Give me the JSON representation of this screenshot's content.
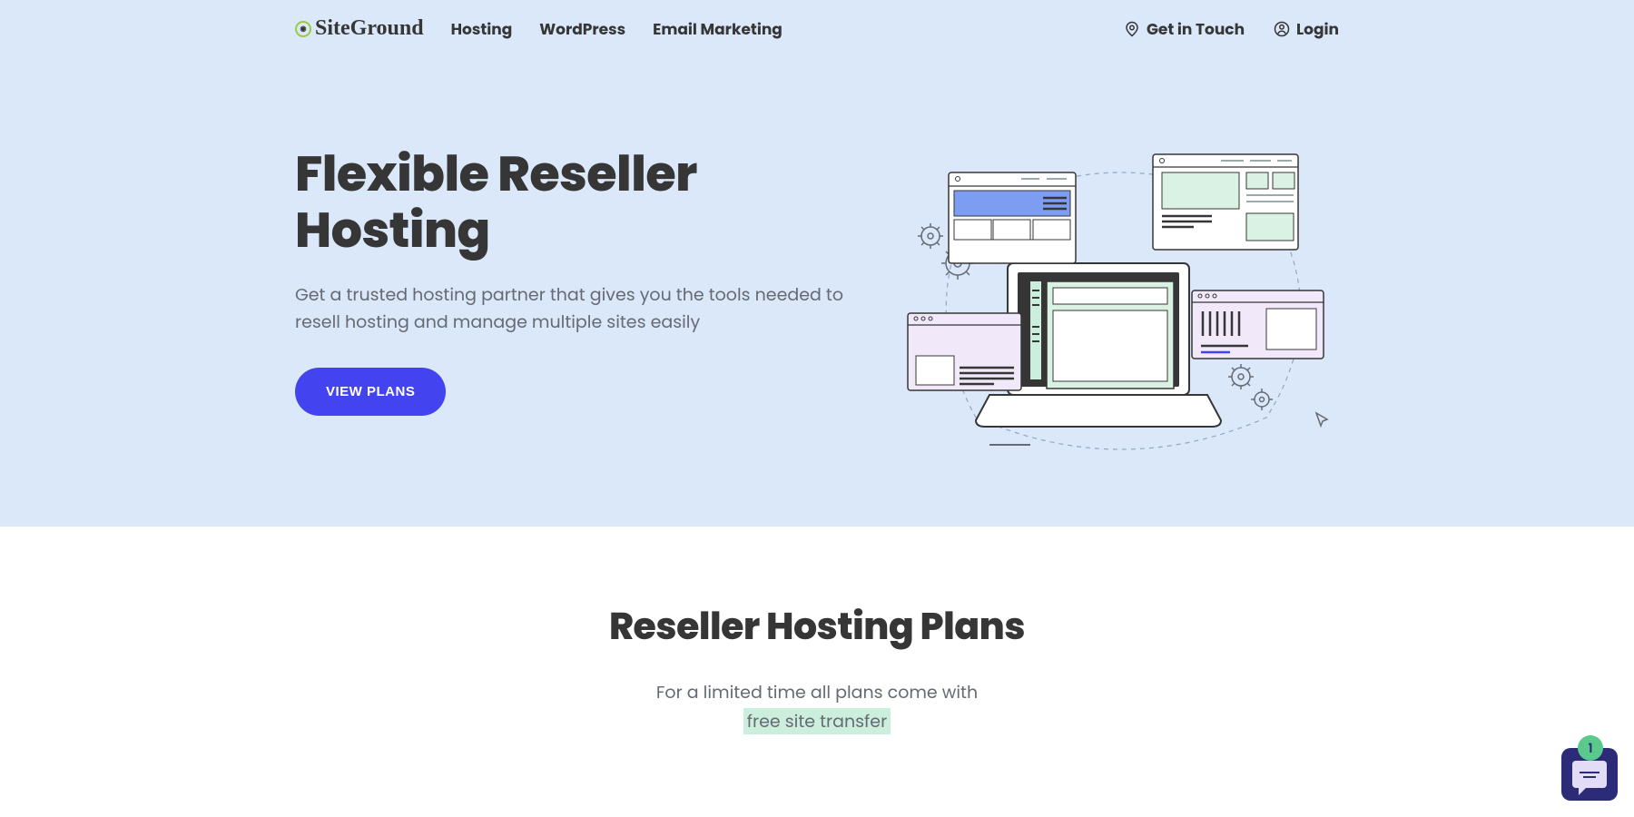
{
  "brand": "SiteGround",
  "nav": {
    "items": [
      "Hosting",
      "WordPress",
      "Email Marketing"
    ],
    "contact": "Get in Touch",
    "login": "Login"
  },
  "hero": {
    "title": "Flexible Reseller Hosting",
    "description": "Get a trusted hosting partner that gives you the tools needed to resell hosting and manage multiple sites easily",
    "cta": "VIEW PLANS"
  },
  "plans": {
    "title": "Reseller Hosting Plans",
    "subtitle_lead": "For a limited time all plans come with ",
    "subtitle_highlight": "free site transfer"
  },
  "chat": {
    "badge": "1"
  }
}
